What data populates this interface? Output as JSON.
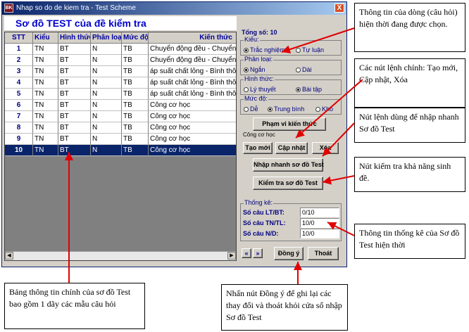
{
  "window": {
    "title": "Nhap so do de kiem tra - Test Scheme",
    "icon_text": "BK",
    "close_label": "X"
  },
  "heading": "Sơ đồ TEST của đề kiểm tra",
  "table": {
    "columns": [
      "STT",
      "Kiểu",
      "Hình thức",
      "Phân loại",
      "Mức độ",
      "Kiến thức"
    ],
    "rows": [
      {
        "stt": "1",
        "kieu": "TN",
        "hinh_thuc": "BT",
        "phan_loai": "N",
        "muc_do": "TB",
        "kien_thuc": "Chuyển động đều - Chuyển"
      },
      {
        "stt": "2",
        "kieu": "TN",
        "hinh_thuc": "BT",
        "phan_loai": "N",
        "muc_do": "TB",
        "kien_thuc": "Chuyển động đều - Chuyển"
      },
      {
        "stt": "3",
        "kieu": "TN",
        "hinh_thuc": "BT",
        "phan_loai": "N",
        "muc_do": "TB",
        "kien_thuc": "áp suất chất lỏng - Bình thôn"
      },
      {
        "stt": "4",
        "kieu": "TN",
        "hinh_thuc": "BT",
        "phan_loai": "N",
        "muc_do": "TB",
        "kien_thuc": "áp suất chất lỏng - Bình thôn"
      },
      {
        "stt": "5",
        "kieu": "TN",
        "hinh_thuc": "BT",
        "phan_loai": "N",
        "muc_do": "TB",
        "kien_thuc": "áp suất chất lỏng - Bình thôn"
      },
      {
        "stt": "6",
        "kieu": "TN",
        "hinh_thuc": "BT",
        "phan_loai": "N",
        "muc_do": "TB",
        "kien_thuc": "Công cơ học"
      },
      {
        "stt": "7",
        "kieu": "TN",
        "hinh_thuc": "BT",
        "phan_loai": "N",
        "muc_do": "TB",
        "kien_thuc": "Công cơ học"
      },
      {
        "stt": "8",
        "kieu": "TN",
        "hinh_thuc": "BT",
        "phan_loai": "N",
        "muc_do": "TB",
        "kien_thuc": "Công cơ học"
      },
      {
        "stt": "9",
        "kieu": "TN",
        "hinh_thuc": "BT",
        "phan_loai": "N",
        "muc_do": "TB",
        "kien_thuc": "Công cơ học"
      },
      {
        "stt": "10",
        "kieu": "TN",
        "hinh_thuc": "BT",
        "phan_loai": "N",
        "muc_do": "TB",
        "kien_thuc": "Công cơ học"
      }
    ],
    "selected_row": "10"
  },
  "panel": {
    "total": "Tổng số: 10",
    "kieu": {
      "title": "Kiểu:",
      "options": [
        "Trắc nghiệm",
        "Tự luận"
      ],
      "selected": "Trắc nghiệm"
    },
    "phan_loai": {
      "title": "Phân loại:",
      "options": [
        "Ngắn",
        "Dài"
      ],
      "selected": "Ngắn"
    },
    "hinh_thuc": {
      "title": "Hình thức:",
      "options": [
        "Lý thuyết",
        "Bài tập"
      ],
      "selected": "Bài tập"
    },
    "muc_do": {
      "title": "Mức độ:",
      "options": [
        "Dễ",
        "Trung bình",
        "Khó"
      ],
      "selected": "Trung bình"
    },
    "pham_vi_button": "Phạm vi kiến thức",
    "knowledge_value": "Công cơ học",
    "new_button": "Tạo mới",
    "update_button": "Cập nhật",
    "delete_button": "Xóa",
    "quick_input_button": "Nhập nhanh sơ đồ Test",
    "check_button": "Kiểm tra sơ đồ Test",
    "stats": {
      "title": "Thống kê:",
      "lt_bt_label": "Số câu LT/BT:",
      "lt_bt_value": "0/10",
      "tn_tl_label": "Số câu TN/TL:",
      "tn_tl_value": "10/0",
      "n_d_label": "Số câu N/D:",
      "n_d_value": "10/0"
    },
    "up_label": "«",
    "down_label": "»",
    "ok_button": "Đồng ý",
    "exit_button": "Thoát"
  },
  "annotations": {
    "current_row": "Thông tin của dòng (câu hỏi) hiện thời đang được chọn.",
    "main_buttons": "Các nút lệnh chính: Tạo mới, Cập nhật, Xóa",
    "quick_input": "Nút lệnh dùng để nhập nhanh Sơ đồ Test",
    "check": "Nút kiểm tra khả năng sinh đề.",
    "stats": "Thông tin thống kê của Sơ đồ Test hiện thời",
    "table": "Bảng thông tin chính của sơ đồ Test bao gồm 1 dãy các mẫu câu hỏi",
    "ok": "Nhấn nút Đồng ý để ghi lại các thay đổi và thoát khỏi cửa sổ nhập Sơ đồ Test"
  }
}
